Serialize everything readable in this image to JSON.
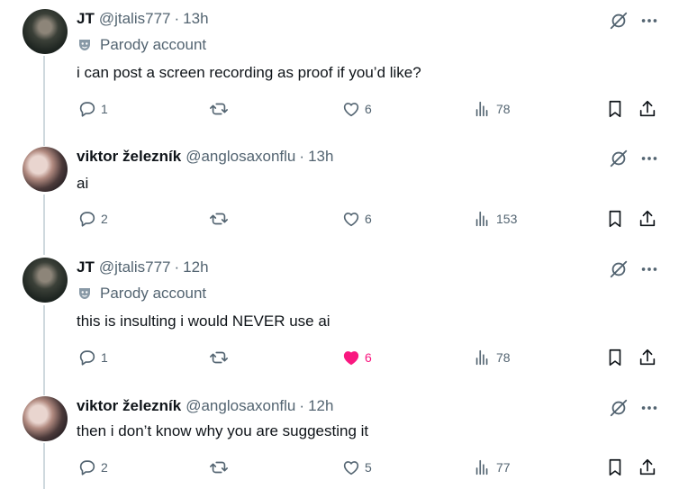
{
  "tweets": [
    {
      "name": "JT",
      "handle": "@jtalis777",
      "dot": "·",
      "time": "13h",
      "parody": "Parody account",
      "text": "i can post a screen recording as proof if you’d like?",
      "replies": "1",
      "likes": "6",
      "liked": false,
      "views": "78"
    },
    {
      "name": "viktor železník",
      "handle": "@anglosaxonflu",
      "dot": "·",
      "time": "13h",
      "parody": null,
      "text": "ai",
      "replies": "2",
      "likes": "6",
      "liked": false,
      "views": "153"
    },
    {
      "name": "JT",
      "handle": "@jtalis777",
      "dot": "·",
      "time": "12h",
      "parody": "Parody account",
      "text": "this is insulting i would NEVER use ai",
      "replies": "1",
      "likes": "6",
      "liked": true,
      "views": "78"
    },
    {
      "name": "viktor železník",
      "handle": "@anglosaxonflu",
      "dot": "·",
      "time": "12h",
      "parody": null,
      "text": "then i don’t know why you are suggesting it",
      "replies": "2",
      "likes": "5",
      "liked": false,
      "views": "77"
    }
  ],
  "colors": {
    "text": "#0f1419",
    "muted": "#536471",
    "like": "#f91880",
    "line": "#cfd9de"
  },
  "icons": [
    "reply-icon",
    "repost-icon",
    "like-icon",
    "views-icon",
    "bookmark-icon",
    "share-icon",
    "grok-icon",
    "more-icon",
    "parody-mask-icon"
  ]
}
